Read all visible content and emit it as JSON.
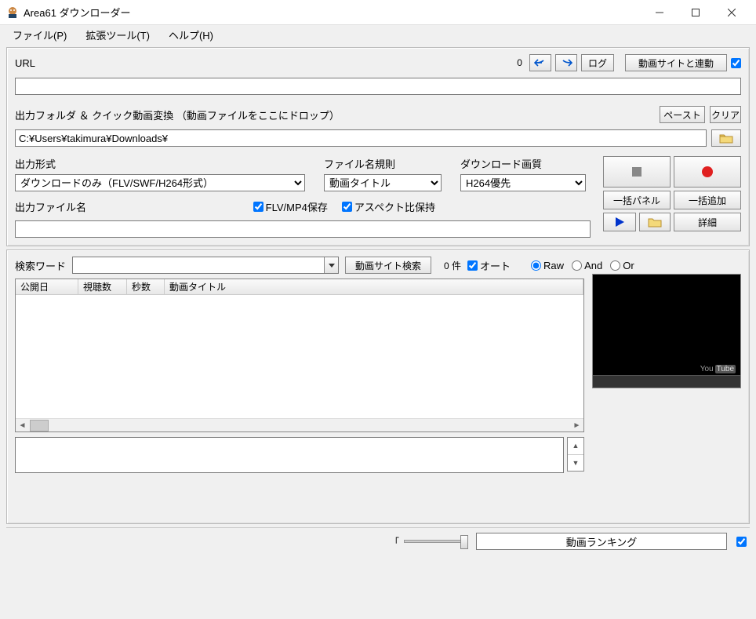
{
  "window": {
    "title": "Area61 ダウンローダー"
  },
  "menu": {
    "file": "ファイル(P)",
    "tools": "拡張ツール(T)",
    "help": "ヘルプ(H)"
  },
  "url_section": {
    "label": "URL",
    "count": "0",
    "log_btn": "ログ",
    "site_link_btn": "動画サイトと連動",
    "url_value": ""
  },
  "folder_section": {
    "label": "出力フォルダ ＆ クイック動画変換 （動画ファイルをここにドロップ）",
    "paste_btn": "ペースト",
    "clear_btn": "クリア",
    "path": "C:¥Users¥takimura¥Downloads¥"
  },
  "format_section": {
    "output_format_label": "出力形式",
    "output_format_value": "ダウンロードのみ（FLV/SWF/H264形式）",
    "filename_rule_label": "ファイル名規則",
    "filename_rule_value": "動画タイトル",
    "quality_label": "ダウンロード画質",
    "quality_value": "H264優先",
    "batch_panel_btn": "一括パネル",
    "batch_add_btn": "一括追加",
    "detail_btn": "詳細",
    "output_filename_label": "出力ファイル名",
    "save_flv_checkbox": "FLV/MP4保存",
    "aspect_checkbox": "アスペクト比保持",
    "output_filename_value": ""
  },
  "search_section": {
    "label": "検索ワード",
    "value": "",
    "search_btn": "動画サイト検索",
    "count_label": "0 件",
    "auto_checkbox": "オート",
    "radio_raw": "Raw",
    "radio_and": "And",
    "radio_or": "Or",
    "columns": {
      "date": "公開日",
      "views": "視聴数",
      "seconds": "秒数",
      "title": "動画タイトル"
    }
  },
  "bottom": {
    "ranking_label": "動画ランキング"
  },
  "preview": {
    "logo_text": "You",
    "logo_badge": "Tube"
  }
}
